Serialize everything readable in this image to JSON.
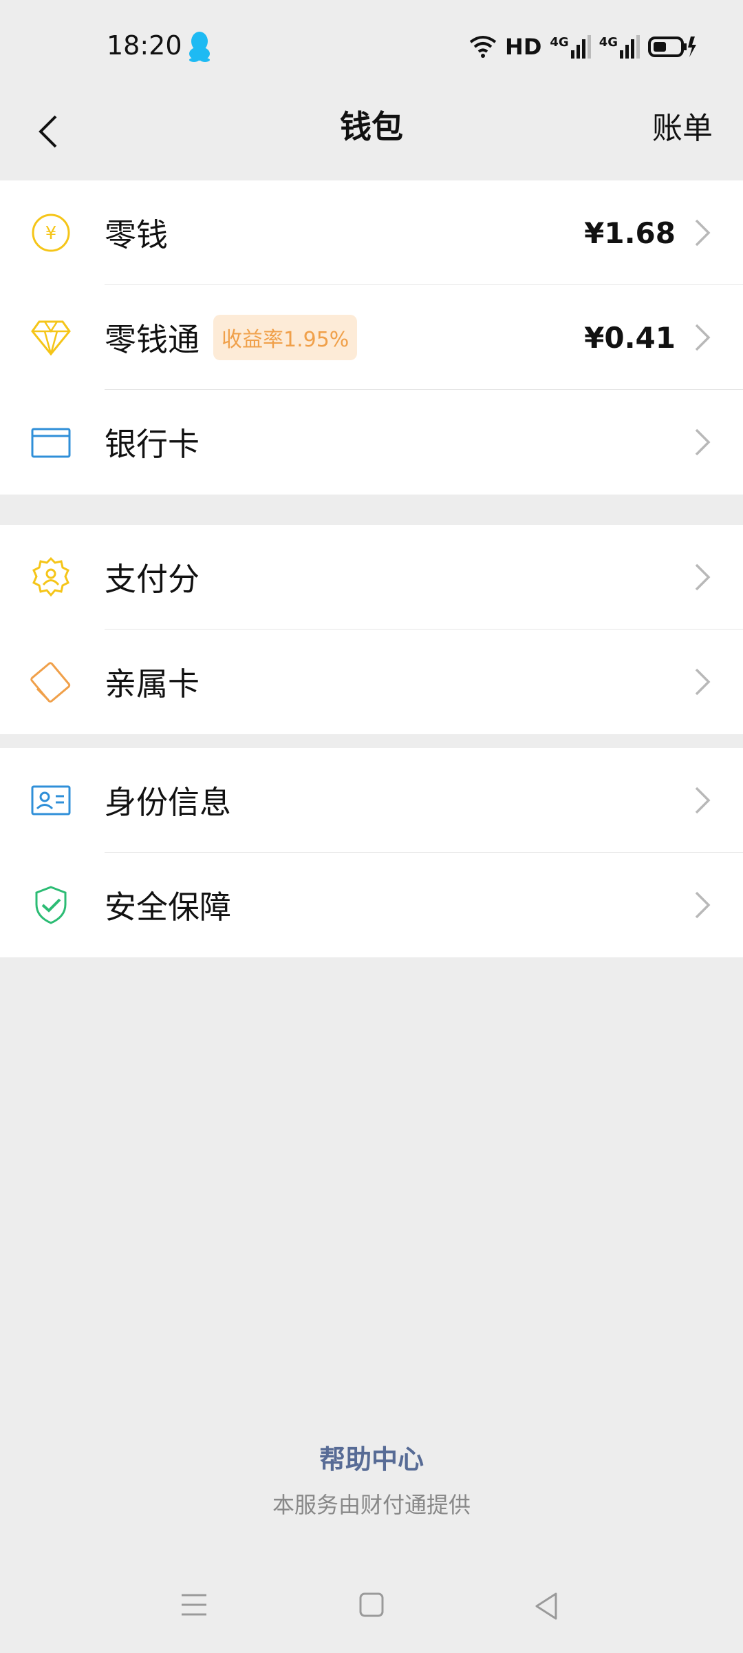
{
  "status_bar": {
    "time": "18:20",
    "hd_label": "HD",
    "net1": "4G",
    "net2": "4G"
  },
  "nav": {
    "title": "钱包",
    "right_action": "账单"
  },
  "groups": [
    {
      "items": [
        {
          "label": "零钱",
          "value": "¥1.68",
          "icon": "yuan-coin-icon"
        },
        {
          "label": "零钱通",
          "badge": "收益率1.95%",
          "value": "¥0.41",
          "icon": "diamond-icon"
        },
        {
          "label": "银行卡",
          "icon": "bank-card-icon"
        }
      ]
    },
    {
      "items": [
        {
          "label": "支付分",
          "icon": "credit-score-icon"
        },
        {
          "label": "亲属卡",
          "icon": "family-card-icon"
        }
      ]
    },
    {
      "items": [
        {
          "label": "身份信息",
          "icon": "id-card-icon"
        },
        {
          "label": "安全保障",
          "icon": "shield-check-icon"
        }
      ]
    }
  ],
  "footer": {
    "help_link": "帮助中心",
    "provider_note": "本服务由财付通提供"
  },
  "colors": {
    "accent_link": "#576b95",
    "badge_text": "#f0a04a",
    "badge_bg": "#fdebd7",
    "yellow_icon": "#f5c518",
    "blue_icon": "#2f8fd8",
    "green_icon": "#2cbc74",
    "orange_icon": "#f0a04a"
  }
}
